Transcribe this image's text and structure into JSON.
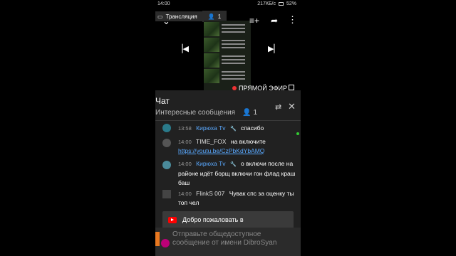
{
  "status_bar": {
    "time": "14:00",
    "net_speed": "217КБ/с",
    "battery": "52%"
  },
  "stream_banner": {
    "label": "Трансляция",
    "viewer_count": "1"
  },
  "player": {
    "live_label": "ПРЯМОЙ ЭФИР",
    "icons": [
      "chevron-down-icon",
      "add-to-queue-icon",
      "share-icon",
      "more-vert-icon",
      "skip-previous-icon",
      "skip-next-icon",
      "fullscreen-icon"
    ]
  },
  "chat": {
    "title": "Чат",
    "subtitle": "Интересные сообщения",
    "viewer_count": "1",
    "messages": [
      {
        "time": "13:58",
        "author": "Кирюха Tv",
        "is_mod": true,
        "text": "спасибо",
        "link": ""
      },
      {
        "time": "14:00",
        "author": "TIME_FOX",
        "is_mod": false,
        "text": "на включите",
        "link": "https://youtu.be/CzPbKdYbAMQ"
      },
      {
        "time": "14:00",
        "author": "Кирюха Tv",
        "is_mod": true,
        "text": "о включи после на районе идёт борщ включи гон флад краш баш",
        "link": ""
      },
      {
        "time": "14:00",
        "author": "FlinkS 007",
        "is_mod": false,
        "text": "Чувак спс за оценку ты топ чел",
        "link": ""
      }
    ],
    "welcome_text": "Добро пожаловать в",
    "input_placeholder": "Отправьте общедоступное сообщение от имени DibroSyan"
  },
  "colors": {
    "accent_blue": "#5aa9ff",
    "live_red": "#e33333",
    "chat_bg": "#212121"
  }
}
